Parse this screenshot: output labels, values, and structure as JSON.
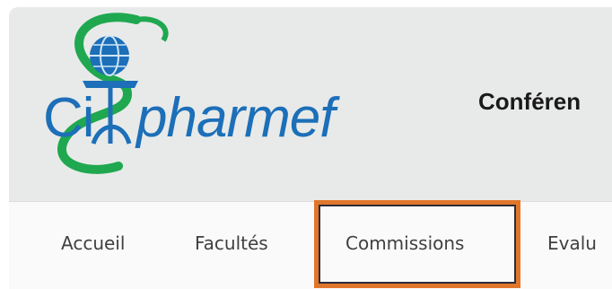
{
  "logo": {
    "text_ci": "Ci",
    "text_pharmef": "pharmef",
    "colors": {
      "blue": "#1c6fb8",
      "green": "#1fa84f"
    }
  },
  "header": {
    "title": "Conféren"
  },
  "nav": {
    "items": [
      {
        "label": "Accueil"
      },
      {
        "label": "Facultés"
      },
      {
        "label": "Commissions"
      },
      {
        "label": "Evalu"
      }
    ]
  },
  "colors": {
    "highlight_border": "#e0762b",
    "background": "#e8eae9"
  }
}
